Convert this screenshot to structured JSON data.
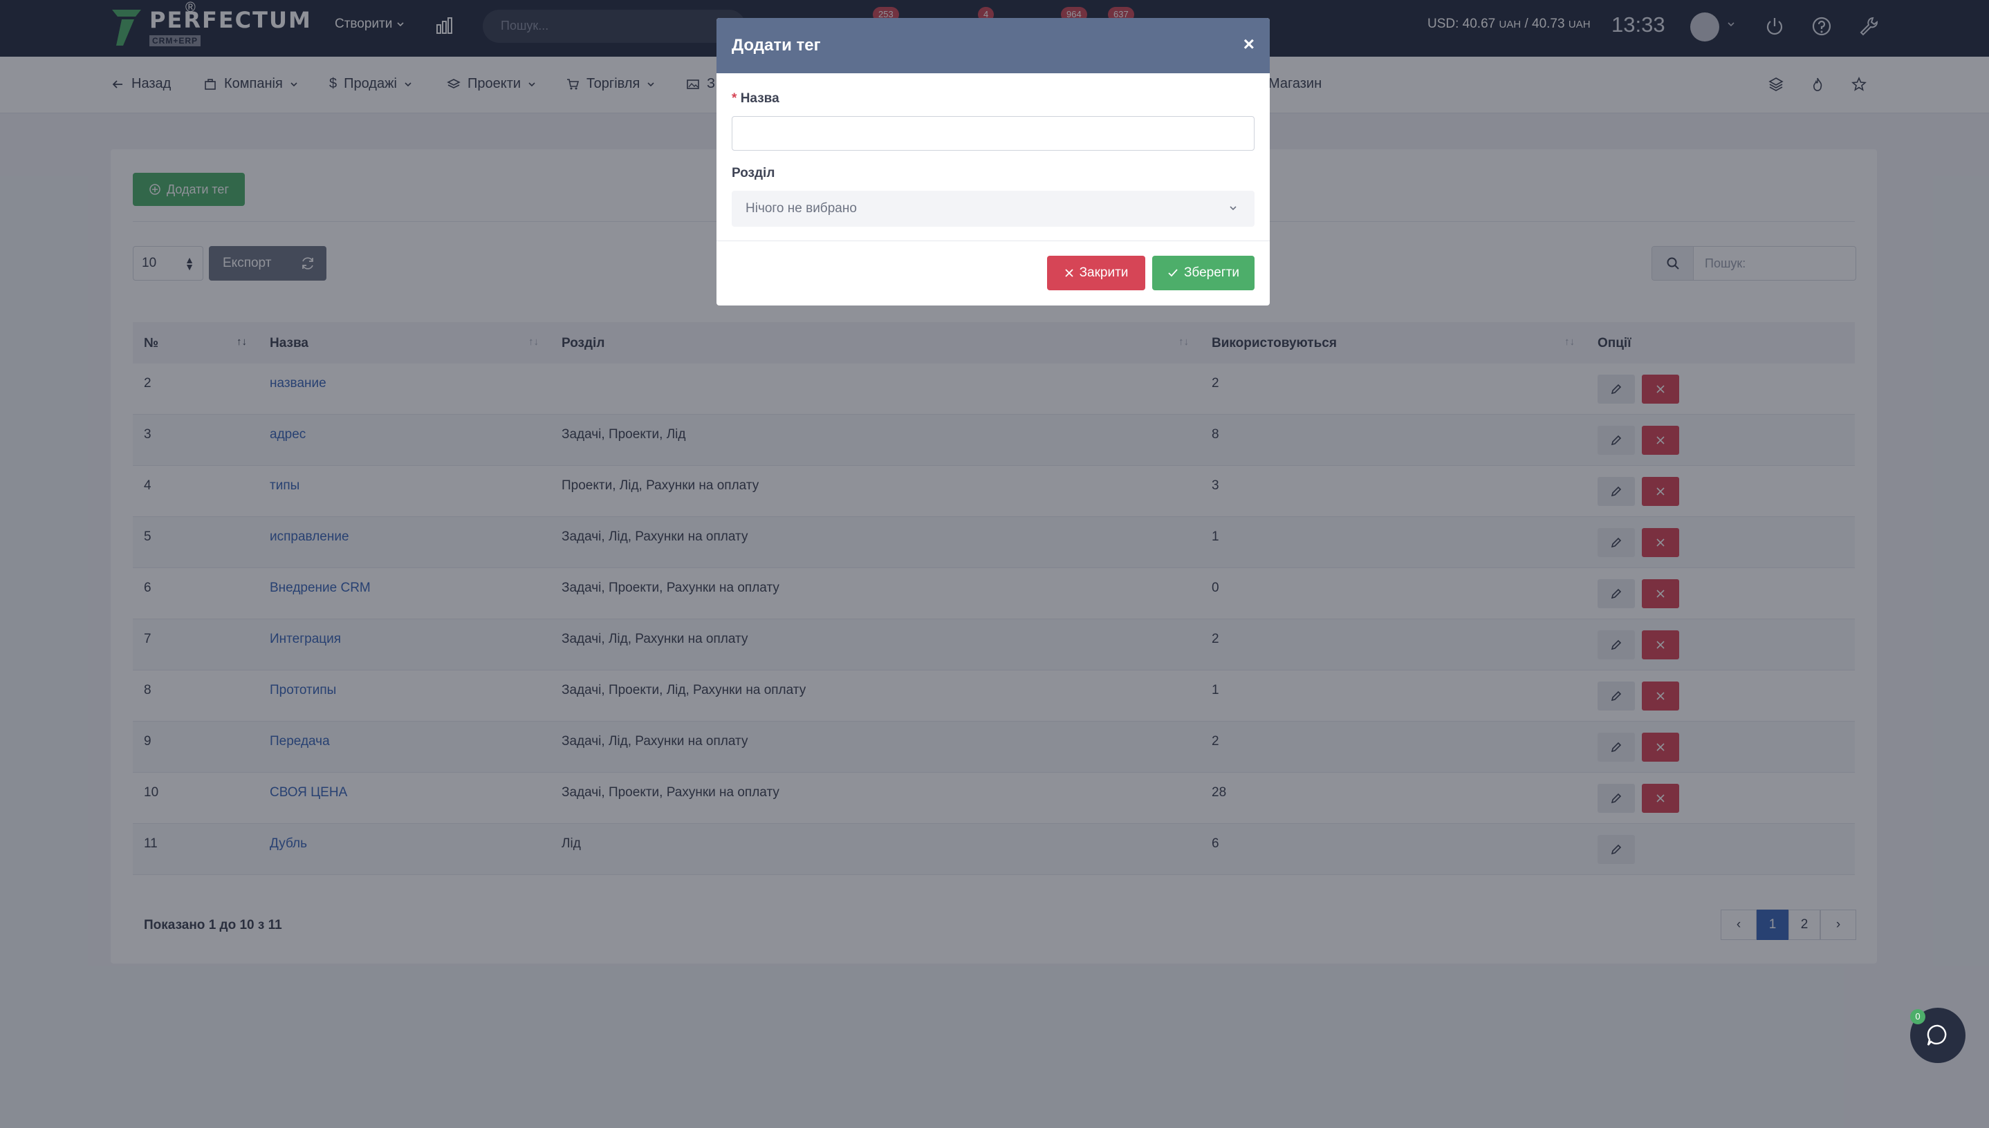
{
  "topbar": {
    "logo_text": "PERFECTUM",
    "logo_sub": "CRM+ERP",
    "logo_reg": "®",
    "create_label": "Створити",
    "search_placeholder": "Пошук...",
    "badges": [
      "253",
      "4",
      "964",
      "637"
    ],
    "rate_usd": "USD: 40.67",
    "rate_uah1": "UAH",
    "rate_sep": " / 40.73",
    "rate_uah2": "UAH",
    "time": "13:33"
  },
  "subnav": {
    "back": "Назад",
    "items": [
      "Компанія",
      "Продажі",
      "Проекти",
      "Торгівля",
      "З",
      "Магазин"
    ]
  },
  "toolbar": {
    "add_tag": "Додати тег",
    "page_size": "10",
    "export": "Експорт",
    "search_placeholder": "Пошук:"
  },
  "table": {
    "headers": [
      "№",
      "Назва",
      "Розділ",
      "Використовуються",
      "Опції"
    ],
    "rows": [
      {
        "num": "2",
        "name": "название",
        "section": "",
        "used": "2"
      },
      {
        "num": "3",
        "name": "адрес",
        "section": "Задачі, Проекти, Лід",
        "used": "8"
      },
      {
        "num": "4",
        "name": "типы",
        "section": "Проекти, Лід, Рахунки на оплату",
        "used": "3"
      },
      {
        "num": "5",
        "name": "исправление",
        "section": "Задачі, Лід, Рахунки на оплату",
        "used": "1"
      },
      {
        "num": "6",
        "name": "Внедрение CRM",
        "section": "Задачі, Проекти, Рахунки на оплату",
        "used": "0"
      },
      {
        "num": "7",
        "name": "Интеграция",
        "section": "Задачі, Лід, Рахунки на оплату",
        "used": "2"
      },
      {
        "num": "8",
        "name": "Прототипы",
        "section": "Задачі, Проекти, Лід, Рахунки на оплату",
        "used": "1"
      },
      {
        "num": "9",
        "name": "Передача",
        "section": "Задачі, Лід, Рахунки на оплату",
        "used": "2"
      },
      {
        "num": "10",
        "name": "СВОЯ ЦЕНА",
        "section": "Задачі, Проекти, Рахунки на оплату",
        "used": "28"
      },
      {
        "num": "11",
        "name": "Дубль",
        "section": "Лід",
        "used": "6"
      }
    ]
  },
  "footer": {
    "shown": "Показано 1 до 10 з 11",
    "pages": [
      "1",
      "2"
    ]
  },
  "chat": {
    "count": "0"
  },
  "modal": {
    "title": "Додати тег",
    "close_x": "×",
    "name_required": "*",
    "name_label": "Назва",
    "name_value": "",
    "section_label": "Розділ",
    "section_value": "Нічого не вибрано",
    "close_btn": "Закрити",
    "save_btn": "Зберегти"
  },
  "colors": {
    "topbar": "#272e41",
    "modal_header": "#5e6f8f",
    "success": "#4dae6a",
    "danger": "#d64556",
    "link": "#3a66b6"
  }
}
